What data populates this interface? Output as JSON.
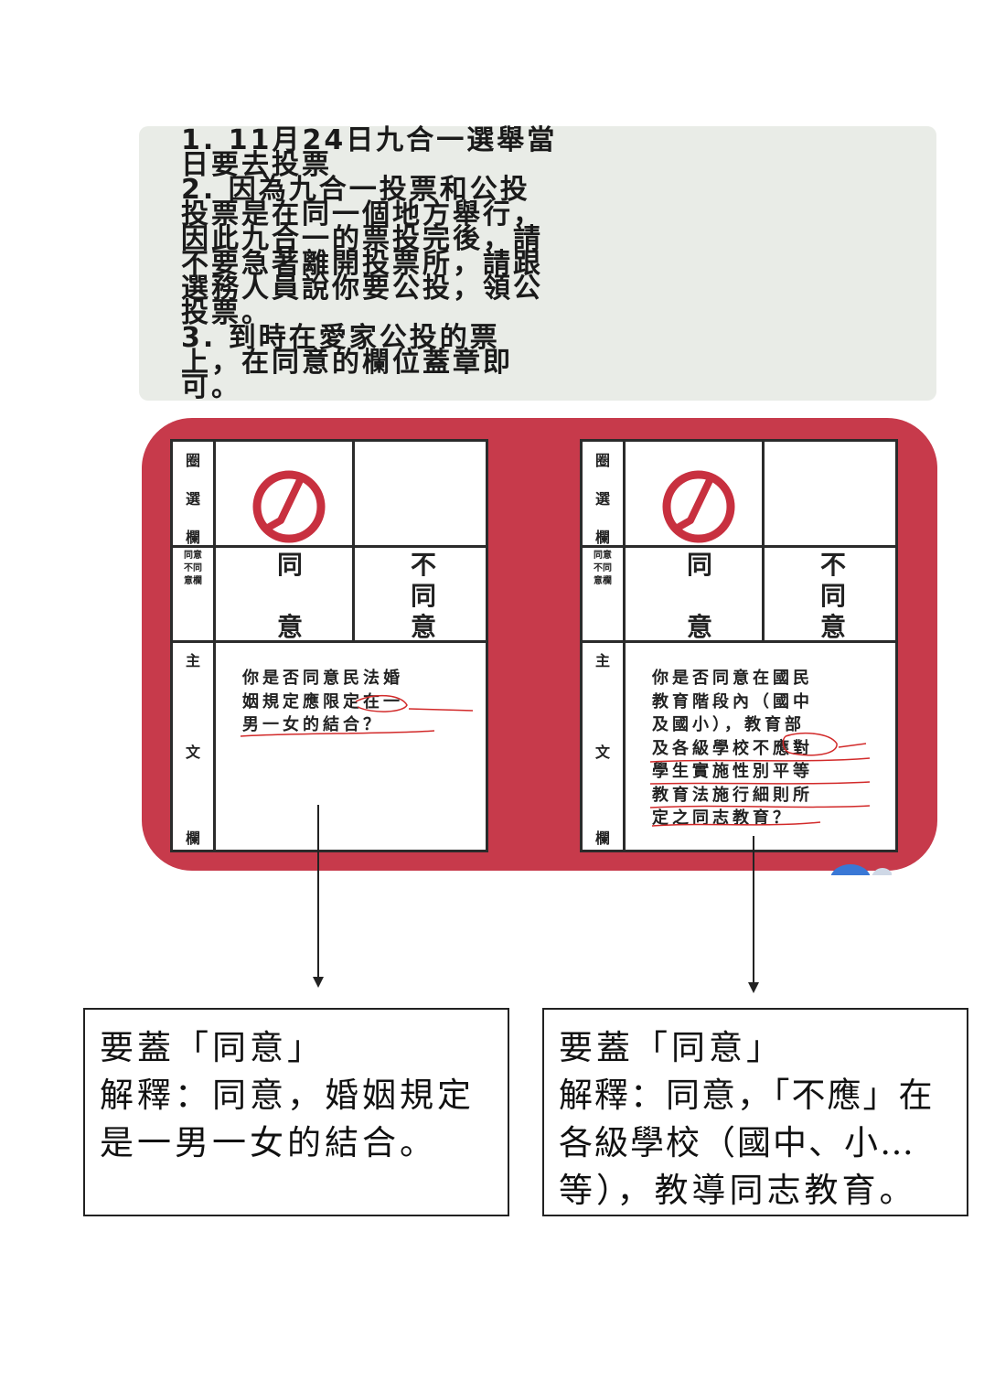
{
  "instructions": {
    "lines": [
      "1. 11月24日九合一選舉當",
      "日要去投票",
      "2. 因為九合一投票和公投",
      "投票是在同一個地方舉行，",
      "因此九合一的票投完後，請",
      "不要急著離開投票所，請跟",
      "選務人員說你要公投，領公",
      "投票。",
      "3. 到時在愛家公投的票",
      "上，在同意的欄位蓋章即",
      "可。"
    ]
  },
  "ballots": [
    {
      "side_labels": {
        "stamp": [
          "圈",
          "選",
          "欄"
        ],
        "vote": "同意不同意欄",
        "main": [
          "主",
          "文",
          "欄"
        ]
      },
      "options": {
        "agree": [
          "同",
          "意"
        ],
        "disagree": [
          "不",
          "同",
          "意"
        ]
      },
      "proposal_lines": [
        "你是否同意民法婚",
        "姻規定應限定在一",
        "男一女的結合？"
      ]
    },
    {
      "side_labels": {
        "stamp": [
          "圈",
          "選",
          "欄"
        ],
        "vote": "同意不同意欄",
        "main": [
          "主",
          "文",
          "欄"
        ]
      },
      "options": {
        "agree": [
          "同",
          "意"
        ],
        "disagree": [
          "不",
          "同",
          "意"
        ]
      },
      "proposal_lines": [
        "你是否同意在國民",
        "教育階段內（國中",
        "及國小），教育部",
        "及各級學校不應對",
        "學生實施性別平等",
        "教育法施行細則所",
        "定之同志教育？"
      ]
    }
  ],
  "explanations": [
    {
      "lines": [
        "要蓋「同意」",
        "解釋：同意，婚姻規定",
        "是一男一女的結合。"
      ]
    },
    {
      "lines": [
        "要蓋「同意」",
        "解釋：同意，「不應」在",
        "各級學校（國中、小…",
        "等），教導同志教育。"
      ]
    }
  ],
  "colors": {
    "panel_red": "#c73a4b",
    "stamp_red": "#c8303f",
    "annotation_red": "#d22a2a",
    "instruction_bg": "#e9ece7"
  }
}
